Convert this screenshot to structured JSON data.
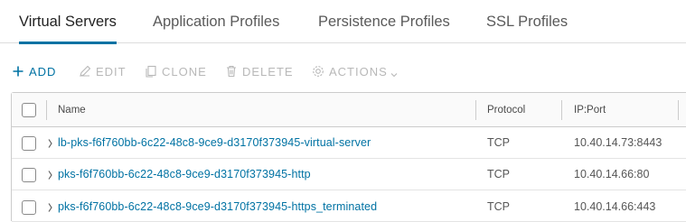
{
  "tabs": [
    {
      "label": "Virtual Servers",
      "active": true
    },
    {
      "label": "Application Profiles",
      "active": false
    },
    {
      "label": "Persistence Profiles",
      "active": false
    },
    {
      "label": "SSL Profiles",
      "active": false
    }
  ],
  "toolbar": {
    "add": {
      "label": "ADD",
      "icon": "plus-icon",
      "enabled": true
    },
    "edit": {
      "label": "EDIT",
      "icon": "pencil-icon",
      "enabled": false
    },
    "clone": {
      "label": "CLONE",
      "icon": "copy-icon",
      "enabled": false
    },
    "delete": {
      "label": "DELETE",
      "icon": "trash-icon",
      "enabled": false
    },
    "actions": {
      "label": "ACTIONS",
      "icon": "gear-icon",
      "enabled": false
    }
  },
  "grid": {
    "columns": [
      "Name",
      "Protocol",
      "IP:Port"
    ],
    "rows": [
      {
        "name": "lb-pks-f6f760bb-6c22-48c8-9ce9-d3170f373945-virtual-server",
        "protocol": "TCP",
        "ip_port": "10.40.14.73:8443"
      },
      {
        "name": "pks-f6f760bb-6c22-48c8-9ce9-d3170f373945-http",
        "protocol": "TCP",
        "ip_port": "10.40.14.66:80"
      },
      {
        "name": "pks-f6f760bb-6c22-48c8-9ce9-d3170f373945-https_terminated",
        "protocol": "TCP",
        "ip_port": "10.40.14.66:443"
      }
    ]
  },
  "colors": {
    "accent": "#0072a3",
    "disabled": "#b8b8b8",
    "border": "#cccccc"
  }
}
